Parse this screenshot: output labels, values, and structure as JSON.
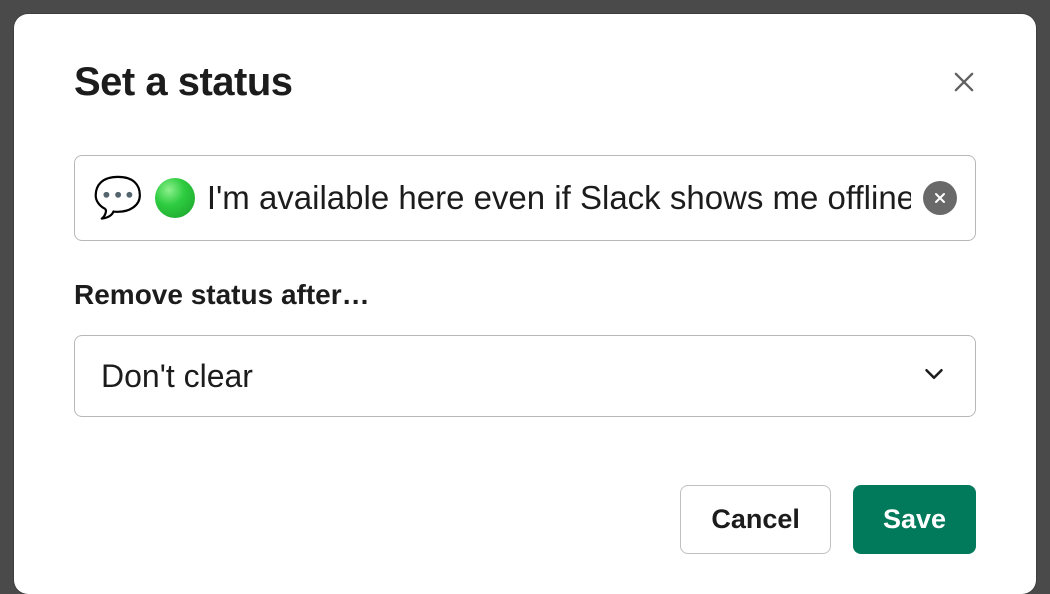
{
  "modal": {
    "title": "Set a status",
    "status_emoji": "💬",
    "status_text": "I'm available here even if Slack shows me offline",
    "remove_after_label": "Remove status after…",
    "remove_after_value": "Don't clear",
    "cancel_label": "Cancel",
    "save_label": "Save"
  }
}
